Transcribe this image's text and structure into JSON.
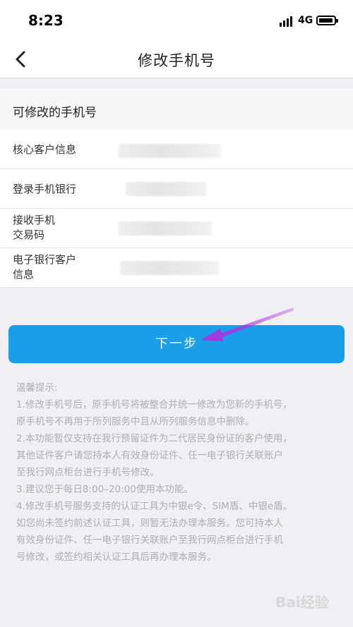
{
  "status_bar": {
    "time": "8:23",
    "network": "4G",
    "icons": [
      "signal-icon",
      "battery-icon"
    ]
  },
  "nav": {
    "title": "修改手机号",
    "back_icon": "back-chevron-icon"
  },
  "section": {
    "title": "可修改的手机号"
  },
  "rows": [
    {
      "label": "核心客户信息"
    },
    {
      "label": "登录手机银行"
    },
    {
      "label_line1": "接收手机",
      "label_line2": "交易码"
    },
    {
      "label_line1": "电子银行客户",
      "label_line2": "信息"
    }
  ],
  "next_button": {
    "label": "下一步"
  },
  "tips": {
    "title": "温馨提示:",
    "lines": [
      "1.修改手机号后，原手机号将被整合并统一修改为您新的手机号，",
      "原手机号不再用于所列服务中且从所列服务信息中删除。",
      "2.本功能暂仅支持在我行预留证件为二代居民身份证的客户使用，",
      "其他证件客户请您持本人有效身份证件、任一电子银行关联账户",
      "至我行网点柜台进行手机号修改。",
      "3.建议您于每日8:00–20:00使用本功能。",
      "4.修改手机号服务支持的认证工具为中银e令、SIM盾、中银e盾。",
      "如您尚未签约前述认证工具，则暂无法办理本服务。您可持本人",
      "有效身份证件、任一电子银行关联账户至我行网点柜台进行手机",
      "号修改，或签约相关认证工具后再办理本服务。"
    ]
  },
  "watermark": {
    "text": "Bai经验"
  },
  "colors": {
    "accent": "#1a9ee8",
    "annotation_arrow": "#b030e0"
  }
}
